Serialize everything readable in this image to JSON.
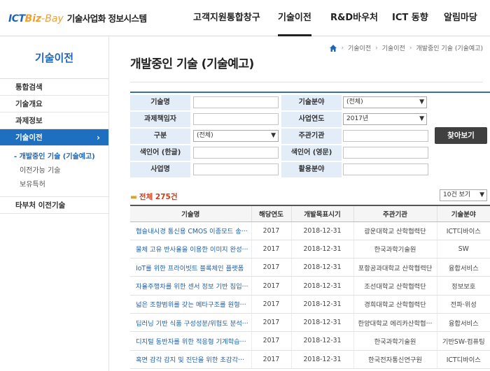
{
  "header": {
    "logo_ict": "ICT",
    "logo_biz": "Biz",
    "logo_dash": "-",
    "logo_bay": "Bay",
    "logo_sys": "기술사업화 정보시스템",
    "nav": [
      "고객지원통합창구",
      "기술이전",
      "R&D바우처",
      "ICT 동향",
      "알림마당"
    ],
    "active_nav": "기술이전"
  },
  "sidebar": {
    "title": "기술이전",
    "items": [
      {
        "label": "통합검색"
      },
      {
        "label": "기술개요"
      },
      {
        "label": "과제정보"
      },
      {
        "label": "기술이전",
        "active": true,
        "arrow": "›"
      }
    ],
    "sub_items": [
      {
        "label": "개발중인 기술 (기술예고)",
        "active": true
      },
      {
        "label": "이전가능 기술"
      },
      {
        "label": "보유특허"
      }
    ],
    "extra_item": "타부처 이전기술"
  },
  "breadcrumb": [
    "기술이전",
    "기술이전",
    "개발중인 기술 (기술예고)"
  ],
  "page_title": "개발중인 기술 (기술예고)",
  "search": {
    "labels": {
      "tech_name": "기술명",
      "tech_field": "기술분야",
      "pm": "과제책임자",
      "year": "사업연도",
      "type": "구분",
      "org": "주관기관",
      "kw_kr": "색인어 (한글)",
      "kw_en": "색인어 (영문)",
      "project": "사업명",
      "use_field": "활용분야"
    },
    "values": {
      "tech_field": "(전체)",
      "year": "2017년",
      "type": "(전체)"
    },
    "button": "찾아보기"
  },
  "results": {
    "total_label": "전체 275건",
    "per_page": "10건 보기",
    "columns": [
      "기술명",
      "해당연도",
      "개발목표시기",
      "주관기관",
      "기술분야"
    ],
    "rows": [
      [
        "협슬내시경 통신용 CMOS 이종모드 송···",
        "2017",
        "2018-12-31",
        "광운대학교 산학협력단",
        "ICT디바이스"
      ],
      [
        "물체 고유 반사율을 이용한 이미지 완성···",
        "2017",
        "2018-12-31",
        "한국과학기술원",
        "SW"
      ],
      [
        "IoT를 위한 프라이빗트 블록체인 플랫폼",
        "2017",
        "2018-12-31",
        "포항공과대학교 산학협력단",
        "융합서비스"
      ],
      [
        "자율주행차를 위한 센서 정보 기반 침입···",
        "2017",
        "2018-12-31",
        "조선대학교 산학협력단",
        "정보보호"
      ],
      [
        "넓은 조향범위를 갖는 메타구조를 원형···",
        "2017",
        "2018-12-31",
        "경희대학교 산학협력단",
        "전파·위성"
      ],
      [
        "딥러닝 기반 식품 구성성분/위험도 분석···",
        "2017",
        "2018-12-31",
        "한양대학교 에리카산학협···",
        "융합서비스"
      ],
      [
        "디지털 동반자를 위한 적응형 기계학습···",
        "2017",
        "2018-12-31",
        "한국과학기술원",
        "기반SW-컴퓨팅"
      ],
      [
        "혹면 감각 감지 및 진단을 위한 초감각···",
        "2017",
        "2018-12-31",
        "한국전자통신연구원",
        "ICT디바이스"
      ]
    ]
  }
}
